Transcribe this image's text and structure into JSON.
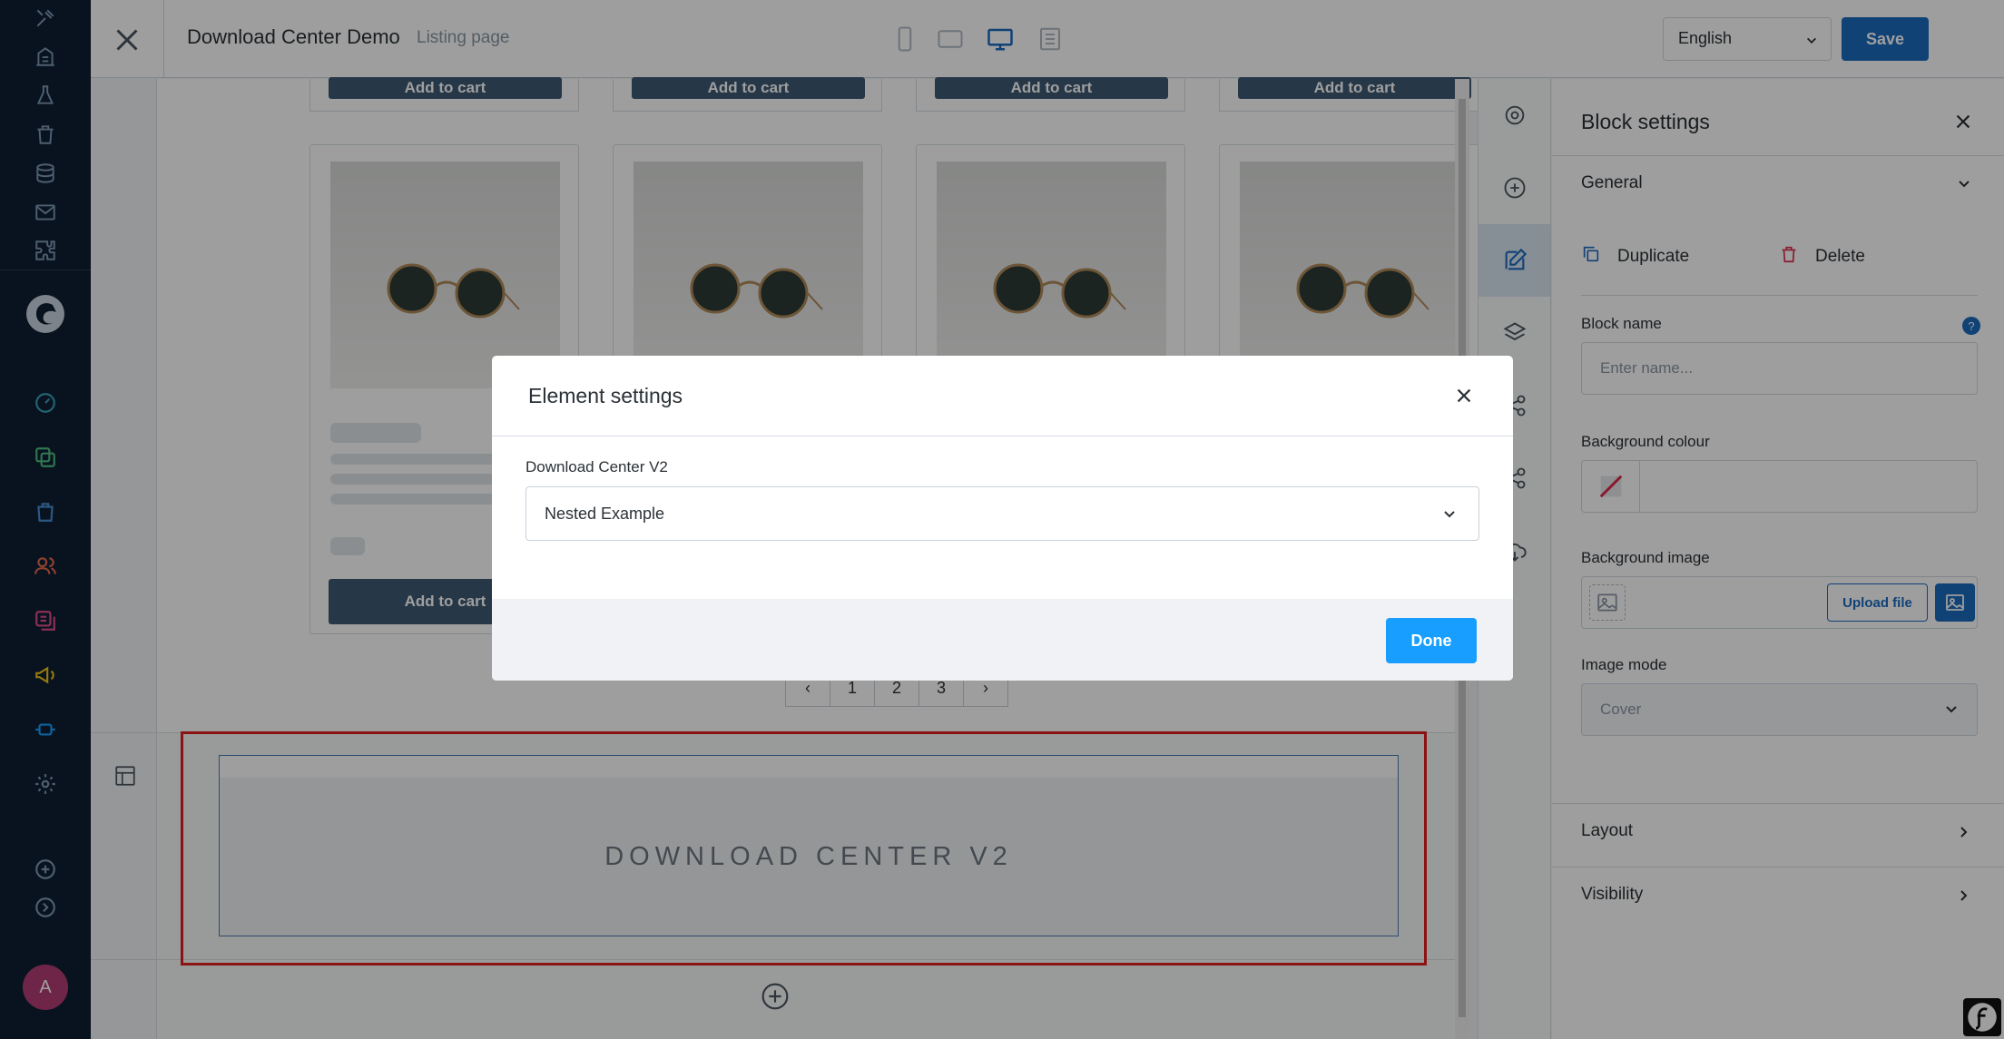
{
  "topbar": {
    "title": "Download Center Demo",
    "subtitle": "Listing page",
    "language": "English",
    "save_label": "Save"
  },
  "listing": {
    "add_to_cart_label": "Add to cart",
    "pagination": [
      "‹",
      "1",
      "2",
      "3",
      "›"
    ]
  },
  "block": {
    "placeholder_text": "DOWNLOAD CENTER V2"
  },
  "panel": {
    "title": "Block settings",
    "general_label": "General",
    "duplicate_label": "Duplicate",
    "delete_label": "Delete",
    "block_name_label": "Block name",
    "block_name_placeholder": "Enter name...",
    "background_colour_label": "Background colour",
    "background_image_label": "Background image",
    "upload_label": "Upload file",
    "image_mode_label": "Image mode",
    "image_mode_value": "Cover",
    "layout_label": "Layout",
    "visibility_label": "Visibility"
  },
  "modal": {
    "title": "Element settings",
    "field_label": "Download Center V2",
    "field_value": "Nested Example",
    "done_label": "Done"
  },
  "colors": {
    "accent": "#1c6bbf",
    "done": "#189eff",
    "nav_bg": "#0e1f33",
    "selection": "#e01f1f",
    "cart_button": "#3e5a74"
  }
}
